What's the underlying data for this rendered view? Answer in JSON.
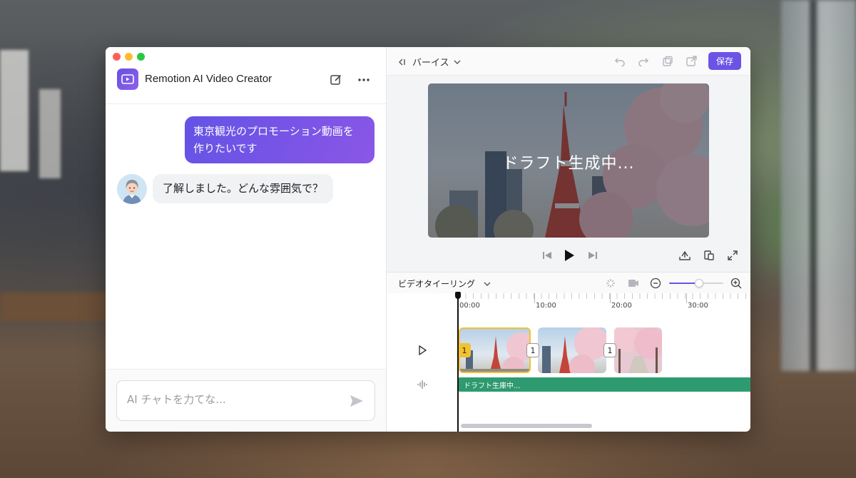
{
  "window": {
    "app_title": "Remotion AI Video Creator"
  },
  "chat": {
    "messages": [
      {
        "role": "user",
        "text_line1": "東京観光のプロモーション動画を",
        "text_line2": "作りたいです"
      },
      {
        "role": "assistant",
        "text": "了解しました。どんな雰囲気で？"
      }
    ],
    "input_placeholder": "AI チャトを力てな..."
  },
  "toolbar": {
    "breadcrumb": "バーイス",
    "save_label": "保存"
  },
  "preview": {
    "overlay_text": "ドラフト生成中..."
  },
  "timeline": {
    "mode_label": "ビデオタイーリング",
    "ruler_labels": [
      "00:00",
      "10:00",
      "20:00",
      "30:00"
    ],
    "clips": [
      {
        "badge": "1"
      },
      {
        "badge": "1"
      },
      {
        "badge": "1"
      }
    ],
    "audio_label": "ドラフト生庫中...",
    "zoom_level": 0.55
  },
  "colors": {
    "accent": "#6b53e6",
    "audio_track": "#2d9a6f",
    "selected_clip": "#f2c230"
  },
  "icons": {
    "app": "video-camera-icon",
    "new_chat": "edit-icon",
    "more": "more-horizontal-icon",
    "send": "send-icon",
    "undo": "undo-icon",
    "redo": "redo-icon",
    "duplicate": "copy-icon",
    "export": "external-link-icon",
    "prev": "skip-back-icon",
    "play": "play-icon",
    "next": "skip-forward-icon"
  }
}
